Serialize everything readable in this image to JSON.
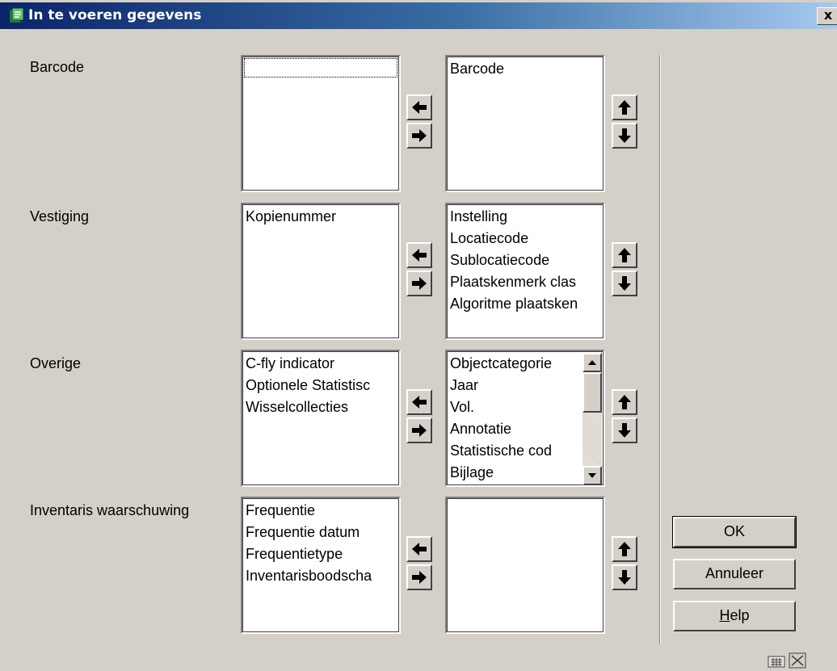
{
  "window": {
    "title": "In te voeren gegevens",
    "close_label": "x"
  },
  "groups": {
    "barcode": {
      "label": "Barcode",
      "available": [],
      "selected": [
        "Barcode"
      ]
    },
    "vestiging": {
      "label": "Vestiging",
      "available": [
        "Kopienummer"
      ],
      "selected": [
        "Instelling",
        "Locatiecode",
        "Sublocatiecode",
        "Plaatskenmerk clas",
        "Algoritme plaatsken"
      ]
    },
    "overige": {
      "label": "Overige",
      "available": [
        "C-fly indicator",
        "Optionele Statistisc",
        "Wisselcollecties"
      ],
      "selected": [
        "Objectcategorie",
        "Jaar",
        "Vol.",
        "Annotatie",
        "Statistische cod",
        "Bijlage"
      ]
    },
    "inventaris": {
      "label": "Inventaris waarschuwing",
      "available": [
        "Frequentie",
        "Frequentie datum",
        "Frequentietype",
        "Inventarisboodscha"
      ],
      "selected": []
    }
  },
  "buttons": {
    "ok": "OK",
    "cancel": "Annuleer",
    "help_prefix": "H",
    "help_rest": "elp"
  },
  "icons": {
    "move_left": "arrow-left-icon",
    "move_right": "arrow-right-icon",
    "move_up": "arrow-up-icon",
    "move_down": "arrow-down-icon"
  },
  "colors": {
    "titlebar_start": "#0a246a",
    "titlebar_end": "#a6caf0",
    "face": "#d4d0c8"
  }
}
